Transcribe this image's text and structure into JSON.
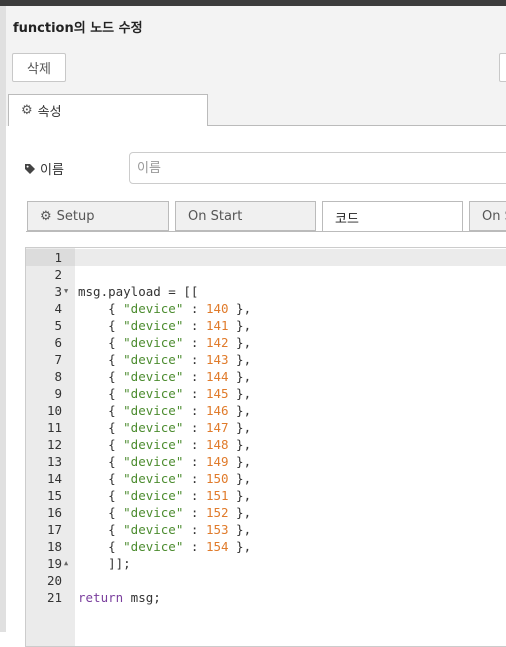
{
  "dialog": {
    "title": "function의 노드 수정"
  },
  "toolbar": {
    "delete_label": "삭제"
  },
  "tabs": {
    "properties_label": "속성"
  },
  "name_field": {
    "label": "이름",
    "placeholder": "이름",
    "value": ""
  },
  "code_tabs": [
    {
      "label": "Setup",
      "icon": "gear-icon"
    },
    {
      "label": "On Start"
    },
    {
      "label": "코드",
      "active": true
    },
    {
      "label": "On S"
    }
  ],
  "editor": {
    "line_numbers": [
      "1",
      "2",
      "3",
      "4",
      "5",
      "6",
      "7",
      "8",
      "9",
      "10",
      "11",
      "12",
      "13",
      "14",
      "15",
      "16",
      "17",
      "18",
      "19",
      "20",
      "21"
    ],
    "lines": [
      "",
      "",
      "msg.payload = [[",
      "    { \"device\" : 140 },",
      "    { \"device\" : 141 },",
      "    { \"device\" : 142 },",
      "    { \"device\" : 143 },",
      "    { \"device\" : 144 },",
      "    { \"device\" : 145 },",
      "    { \"device\" : 146 },",
      "    { \"device\" : 147 },",
      "    { \"device\" : 148 },",
      "    { \"device\" : 149 },",
      "    { \"device\" : 150 },",
      "    { \"device\" : 151 },",
      "    { \"device\" : 152 },",
      "    { \"device\" : 153 },",
      "    { \"device\" : 154 },",
      "    ]];",
      "",
      "return msg;"
    ],
    "fold_markers": {
      "3": "down",
      "19": "up"
    }
  },
  "colors": {
    "keyword": "#7a3e9d",
    "string": "#4c8c2f",
    "number": "#e07b2b",
    "gutter": "#ebebeb"
  }
}
